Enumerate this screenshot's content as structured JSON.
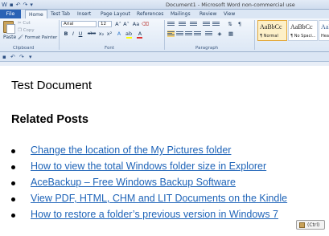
{
  "window": {
    "title": "Document1 - Microsoft Word non-commercial use"
  },
  "tabs": [
    {
      "label": "File"
    },
    {
      "label": "Home"
    },
    {
      "label": "Test Tab"
    },
    {
      "label": "Insert"
    },
    {
      "label": "Page Layout"
    },
    {
      "label": "References"
    },
    {
      "label": "Mailings"
    },
    {
      "label": "Review"
    },
    {
      "label": "View"
    }
  ],
  "ribbon": {
    "clipboard": {
      "paste_label": "Paste",
      "cut_label": "Cut",
      "copy_label": "Copy",
      "format_painter_label": "Format Painter",
      "group_label": "Clipboard"
    },
    "font": {
      "font_name": "Arial",
      "font_size": "12",
      "group_label": "Font",
      "grow_label": "A˄",
      "shrink_label": "A˅",
      "case_label": "Aa",
      "bold_label": "B",
      "italic_label": "I",
      "underline_label": "U",
      "strike_label": "abe",
      "subscript_label": "x₂",
      "superscript_label": "x²",
      "highlight_color": "#ffff00",
      "font_color": "#e03030"
    },
    "paragraph": {
      "group_label": "Paragraph",
      "pilcrow_label": "¶"
    },
    "styles": {
      "items": [
        {
          "sample": "AaBbCc",
          "name": "¶ Normal"
        },
        {
          "sample": "AaBbCc",
          "name": "¶ No Spaci..."
        },
        {
          "sample": "AaBbC",
          "name": "Hea"
        }
      ]
    }
  },
  "document": {
    "title": "Test Document",
    "heading": "Related Posts",
    "posts": [
      {
        "text": "Change the location of the My Pictures folder"
      },
      {
        "text": "How to view the total Windows folder size in Explorer"
      },
      {
        "text": "AceBackup – Free Windows Backup Software"
      },
      {
        "text": "View PDF, HTML, CHM and LIT Documents on the Kindle"
      },
      {
        "text": "How to restore a folder’s previous version in Windows 7"
      }
    ],
    "paste_options_label": "(Ctrl)"
  },
  "colors": {
    "file_tab": "#2a62b5",
    "link": "#1f64b8"
  }
}
